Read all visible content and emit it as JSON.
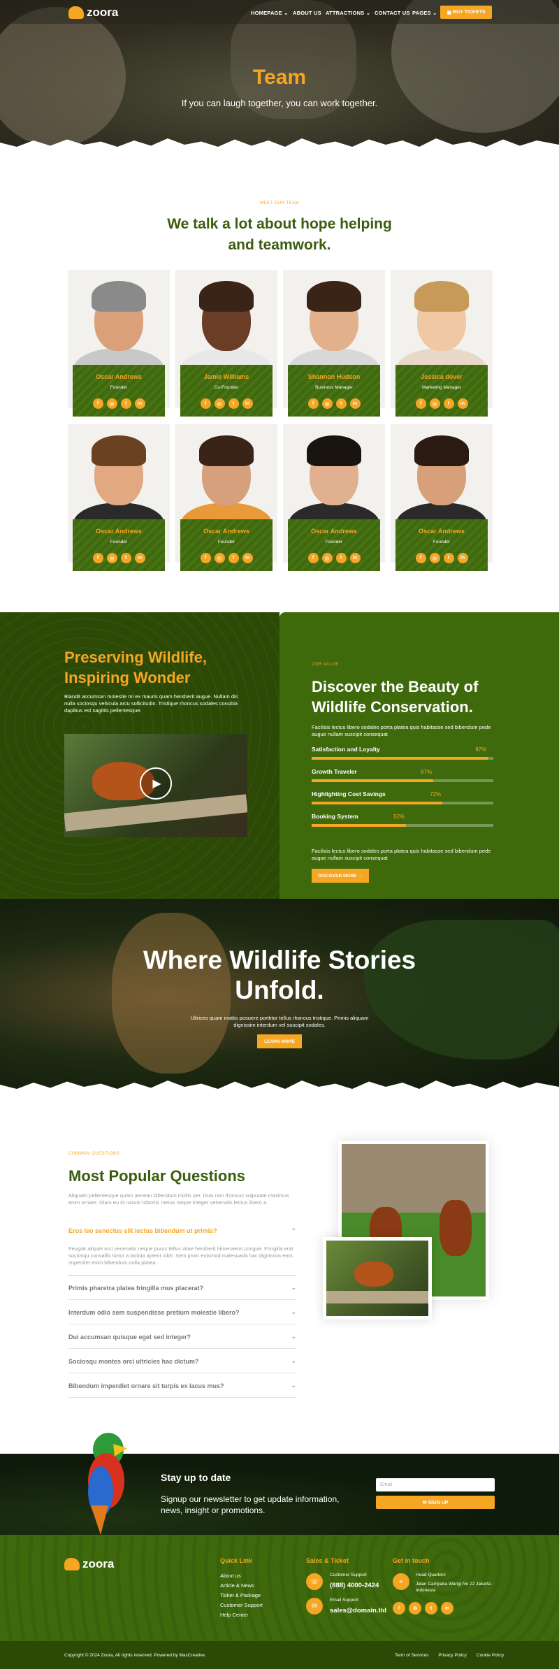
{
  "header": {
    "logo": "zoora",
    "nav": [
      {
        "label": "HOMEPAGE",
        "caret": "⌄"
      },
      {
        "label": "ABOUT US",
        "caret": ""
      },
      {
        "label": "ATTRACTIONS",
        "caret": "⌄"
      },
      {
        "label": "CONTACT US",
        "caret": ""
      },
      {
        "label": "PAGES",
        "caret": "⌄"
      }
    ],
    "buy_label": "BUY TICKETS",
    "ticket_icon": "ticket-icon"
  },
  "hero": {
    "title": "Team",
    "subtitle": "If you can laugh together, you can work together."
  },
  "team": {
    "eyebrow": "MEET OUR TEAM",
    "title": "We talk a lot about hope helping and teamwork.",
    "members": [
      {
        "name": "Oscar Andrews",
        "role": "Founder"
      },
      {
        "name": "Jamie Williams",
        "role": "Co-Founder"
      },
      {
        "name": "Shannon Hudson",
        "role": "Business Manager"
      },
      {
        "name": "Jessica dover",
        "role": "Marketing Manager"
      },
      {
        "name": "Oscar Andrews",
        "role": "Founder"
      },
      {
        "name": "Oscar Andrews",
        "role": "Founder"
      },
      {
        "name": "Oscar Andrews",
        "role": "Founder"
      },
      {
        "name": "Oscar Andrews",
        "role": "Founder"
      }
    ],
    "social_icons": [
      "f",
      "◎",
      "t",
      "in"
    ]
  },
  "wildlife": {
    "title": "Preserving Wildlife, Inspiring Wonder",
    "text": "Blandit accumsan molestie mi ex mauris quam hendrerit augue. Nullam dis nulla sociosqu vehicula arcu sollicitudin. Tristique rhoncus sodales conubia dapibus est sagittis pellentesque."
  },
  "values": {
    "eyebrow": "OUR VALUE",
    "title": "Discover the Beauty of Wildlife Conservation.",
    "text1": "Facilisis lectus libero sodales porta platea quis habitasse sed bibendum pede augue nullam suscipit consequat",
    "bars": [
      {
        "label": "Satisfaction and Loyalty",
        "pct": "97%",
        "value": 97
      },
      {
        "label": "Growth Traveler",
        "pct": "67%",
        "value": 67
      },
      {
        "label": "Highlighting Cost Savings",
        "pct": "72%",
        "value": 72
      },
      {
        "label": "Booking System",
        "pct": "52%",
        "value": 52
      }
    ],
    "text2": "Facilisis lectus libero sodales porta platea quis habitasse sed bibendum pede augue nullam suscipit consequat",
    "button": "DISCOVER MORE  →"
  },
  "tiger": {
    "title": "Where Wildlife Stories Unfold.",
    "text": "Ultrices quam mattis posuere porttitor tellus rhoncus tristique. Primis aliquam dignissim interdum vel suscipit sodales.",
    "button": "LEARN MORE"
  },
  "faq": {
    "eyebrow": "COMMON QUESTIONS",
    "title": "Most Popular Questions",
    "intro": "Aliquam pellentesque quam aenean bibendum mollis per. Duis non rhoncus vulputate maximus enim ornare. Diam eu id rutrum lobortis metus neque integer venenatis lectus libero a.",
    "open_q": "Eros leo senectus elit lectus bibendum ut primis?",
    "open_a": "Feugiat aliquet orci venenatis neque purus tellus vitae hendrerit himenaeos congue. Fringilla erat sociosqu convallis tortor a lacinia aptent nibh. Sem proin euismod malesuada hac dignissim eros imperdiet enim bibendum nulla platea.",
    "questions": [
      "Primis pharetra platea fringilla mus placerat?",
      "Interdum odio sem suspendisse pretium molestie libero?",
      "Dui accumsan quisque eget sed integer?",
      "Sociosqu montes orci ultricies hac dictum?",
      "Bibendum imperdiet ornare sit turpis ex lacus mus?"
    ]
  },
  "newsletter": {
    "title": "Stay up to date",
    "text": "Signup our newsletter to get update information, news, insight or promotions.",
    "placeholder": "Email",
    "button": "✉ SIGN UP"
  },
  "footer": {
    "logo": "zoora",
    "quick_title": "Quick Link",
    "links": [
      "About us",
      "Article & News",
      "Ticket & Package",
      "Customer Support",
      "Help Center"
    ],
    "sales_title": "Sales & Ticket",
    "support_label": "Customer Support",
    "support_value": "(888) 4000-2424",
    "email_label": "Email Support",
    "email_value": "sales@domain.tld",
    "touch_title": "Get in touch",
    "hq_label": "Head Quarters",
    "hq_value": "Jalan Campaka Wangi No 22 Jakarta - Indonesia",
    "copyright": "Copyright © 2024 Zoora, All rights reserved. Powered by MaxCreative.",
    "bottom_links": [
      "Term of Services",
      "Privacy Policy",
      "Cookie Policy"
    ]
  },
  "colors": {
    "accent": "#f5a623",
    "green": "#3f6a0c",
    "dark_green": "#2c4a06"
  }
}
